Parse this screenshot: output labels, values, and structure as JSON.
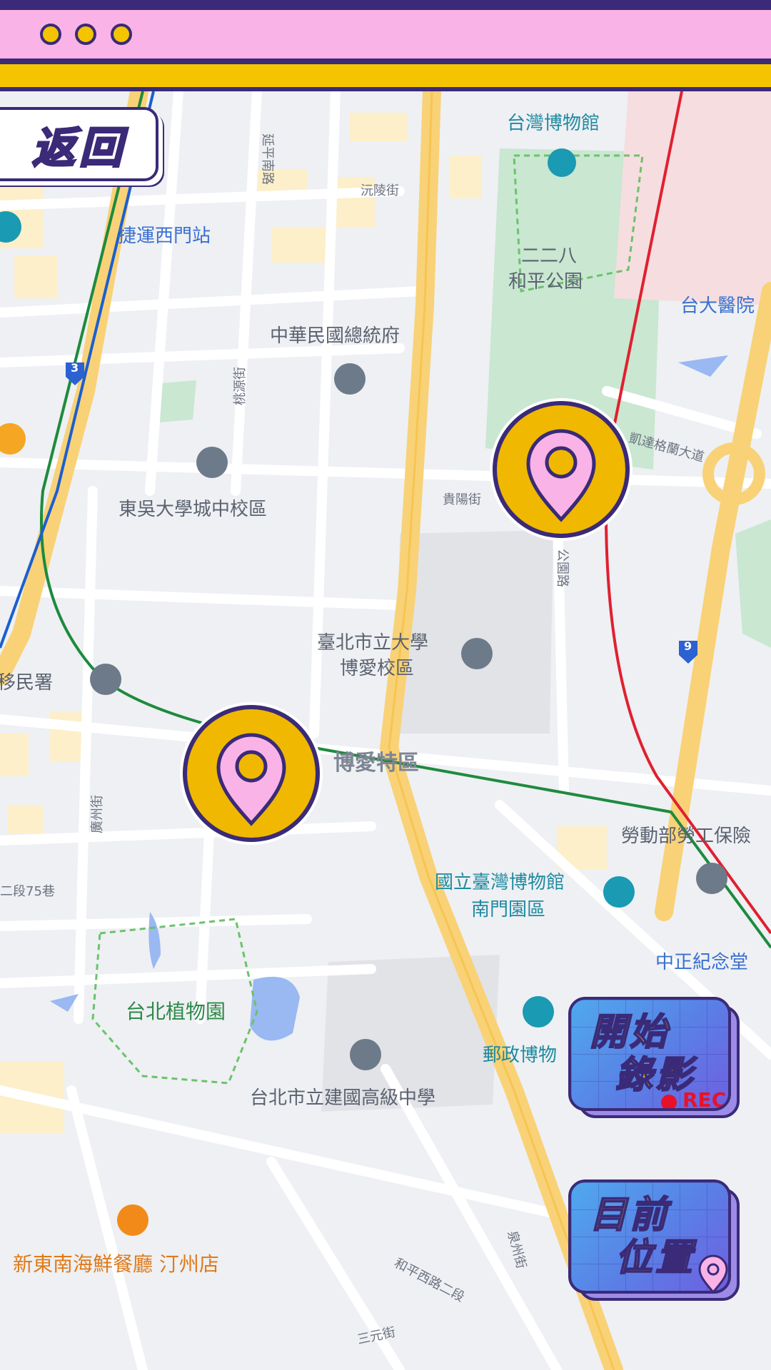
{
  "window": {
    "dots": [
      "dot",
      "dot",
      "dot"
    ]
  },
  "back_button": {
    "label": "返回"
  },
  "record_button": {
    "line1": "開始",
    "line2": "錄影",
    "badge": "REC"
  },
  "location_button": {
    "line1": "目前",
    "line2": "位置"
  },
  "map": {
    "labels": {
      "taiwan_museum": "台灣博物館",
      "ximen_station": "捷運西門站",
      "peace_park_1": "二二八",
      "peace_park_2": "和平公園",
      "ntu_hospital": "台大醫院",
      "presidential_office": "中華民國總統府",
      "soochow_univ": "東吳大學城中校區",
      "guiyang_st": "貴陽街",
      "ketagalan": "凱達格蘭大道",
      "utaipei_1": "臺北市立大學",
      "utaipei_2": "博愛校區",
      "immigration": "移民署",
      "boai_zone": "博愛特區",
      "labor_ministry": "勞動部勞工保險",
      "ntm_nanmen_1": "國立臺灣博物館",
      "ntm_nanmen_2": "南門園區",
      "cks_memorial": "中正紀念堂",
      "botanical_garden": "台北植物園",
      "postal_museum": "郵政博物",
      "jianguo_hs": "台北市立建國高級中學",
      "seafood_rest": "新東南海鮮餐廳 汀州店",
      "heping_w_rd": "和平西路二段",
      "sanyuan_st": "三元街",
      "quanzhou_st": "泉州街",
      "yanping_s_rd": "延平南路",
      "yuanling_st": "沅陵街",
      "taoyuan_st": "桃源街",
      "gongyuan_rd": "公園路",
      "guangzhou_st": "廣州街",
      "lane75": "二段75巷",
      "route_3": "3",
      "route_9": "9"
    }
  },
  "colors": {
    "accent_purple": "#3a2a78",
    "accent_pink": "#f9b3e6",
    "accent_yellow": "#f5c400",
    "rec_red": "#e8112a"
  }
}
